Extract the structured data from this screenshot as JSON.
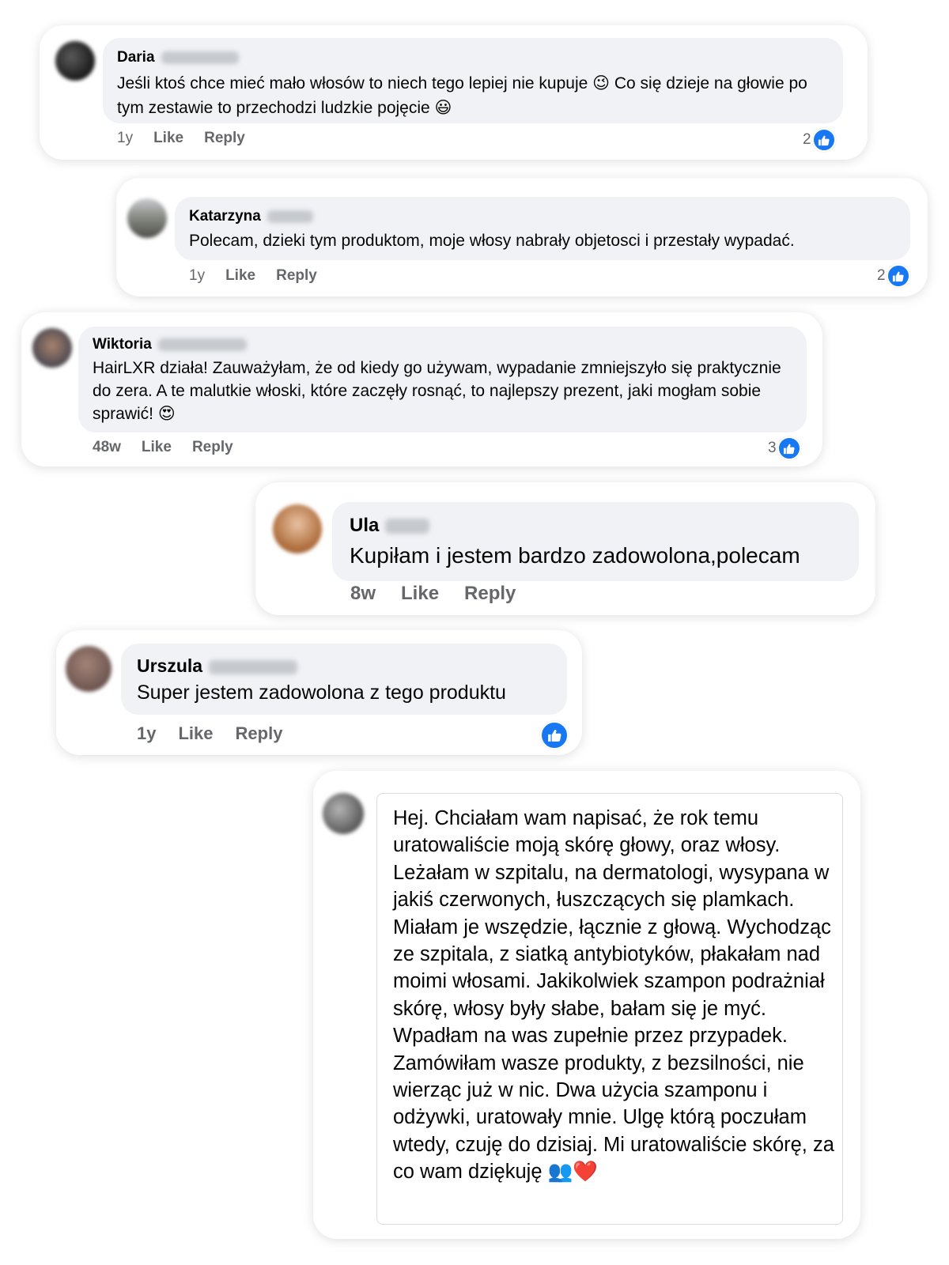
{
  "comments": [
    {
      "author": "Daria",
      "text": "Jeśli ktoś chce mieć mało włosów to niech tego lepiej nie kupuje 😉 Co się dzieje na głowie po tym zestawie to przechodzi ludzkie pojęcie 😃",
      "time": "1y",
      "like": "Like",
      "reply": "Reply",
      "reactions": "2",
      "avatar_color": "#2b2b2b"
    },
    {
      "author": "Katarzyna",
      "text": "Polecam, dzieki tym produktom, moje włosy nabrały objetosci i przestały wypadać.",
      "time": "1y",
      "like": "Like",
      "reply": "Reply",
      "reactions": "2",
      "avatar_color": "#7f8078"
    },
    {
      "author": "Wiktoria",
      "text": "HairLXR działa! Zauważyłam, że od kiedy go używam, wypadanie zmniejszyło się praktycznie do zera. A te malutkie włoski, które zaczęły rosnąć, to najlepszy prezent, jaki mogłam sobie sprawić! 😍",
      "time": "48w",
      "like": "Like",
      "reply": "Reply",
      "reactions": "3",
      "avatar_color": "#6b5a55"
    },
    {
      "author": "Ula",
      "text": "Kupiłam i jestem bardzo zadowolona,polecam",
      "time": "8w",
      "like": "Like",
      "reply": "Reply",
      "avatar_color": "#c48b5c"
    },
    {
      "author": "Urszula",
      "text": "Super jestem zadowolona z tego produktu",
      "time": "1y",
      "like": "Like",
      "reply": "Reply",
      "reactions": "",
      "avatar_color": "#8a6f66"
    },
    {
      "text": "Hej. Chciałam wam napisać, że rok temu uratowaliście moją skórę głowy, oraz włosy. Leżałam w szpitalu, na dermatologi, wysypana w jakiś czerwonych, łuszczących się plamkach. Miałam je wszędzie, łącznie z głową. Wychodząc ze szpitala, z siatką antybiotyków, płakałam nad moimi włosami. Jakikolwiek szampon podrażniał skórę, włosy były słabe, bałam się je myć. Wpadłam na was zupełnie przez przypadek. Zamówiłam wasze produkty, z bezsilności, nie wierząc już w nic. Dwa użycia szamponu i odżywki, uratowały mnie. Ulgę którą poczułam wtedy, czuję do dzisiaj. Mi uratowaliście skórę, za co wam dziękuję 👥❤️",
      "avatar_color": "#6e6e6e"
    }
  ],
  "accent_color": "#1877f2"
}
